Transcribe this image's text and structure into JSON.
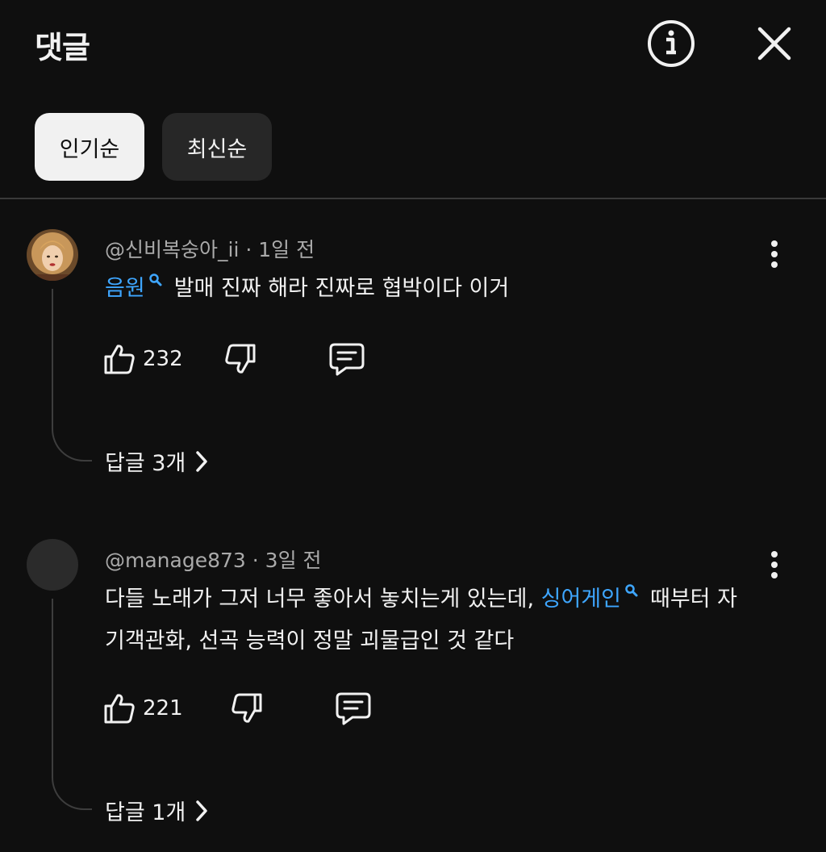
{
  "header": {
    "title": "댓글",
    "info_icon": "info-icon",
    "close_icon": "close-icon"
  },
  "sort": {
    "chips": [
      {
        "label": "인기순",
        "selected": true
      },
      {
        "label": "최신순",
        "selected": false
      }
    ]
  },
  "comments": [
    {
      "author": "@신비복숭아_ii",
      "time": "1일 전",
      "text_parts": [
        {
          "type": "link",
          "text": "음원"
        },
        {
          "type": "text",
          "text": "발매 진짜 해라 진짜로 협박이다 이거"
        }
      ],
      "likes": "232",
      "replies": "답글 3개"
    },
    {
      "author": "@manage873",
      "time": "3일 전",
      "text_parts": [
        {
          "type": "text",
          "text": "다들 노래가 그저 너무 좋아서 놓치는게 있는데, "
        },
        {
          "type": "link",
          "text": "싱어게인"
        },
        {
          "type": "text",
          "text": "때부터 자기객관화, 선곡 능력이 정말 괴물급인 것 같다"
        }
      ],
      "likes": "221",
      "replies": "답글 1개"
    }
  ],
  "colors": {
    "background": "#0f0f0f",
    "link": "#3ea6ff",
    "chip_active": "#f1f1f1",
    "chip_inactive": "#272727"
  }
}
